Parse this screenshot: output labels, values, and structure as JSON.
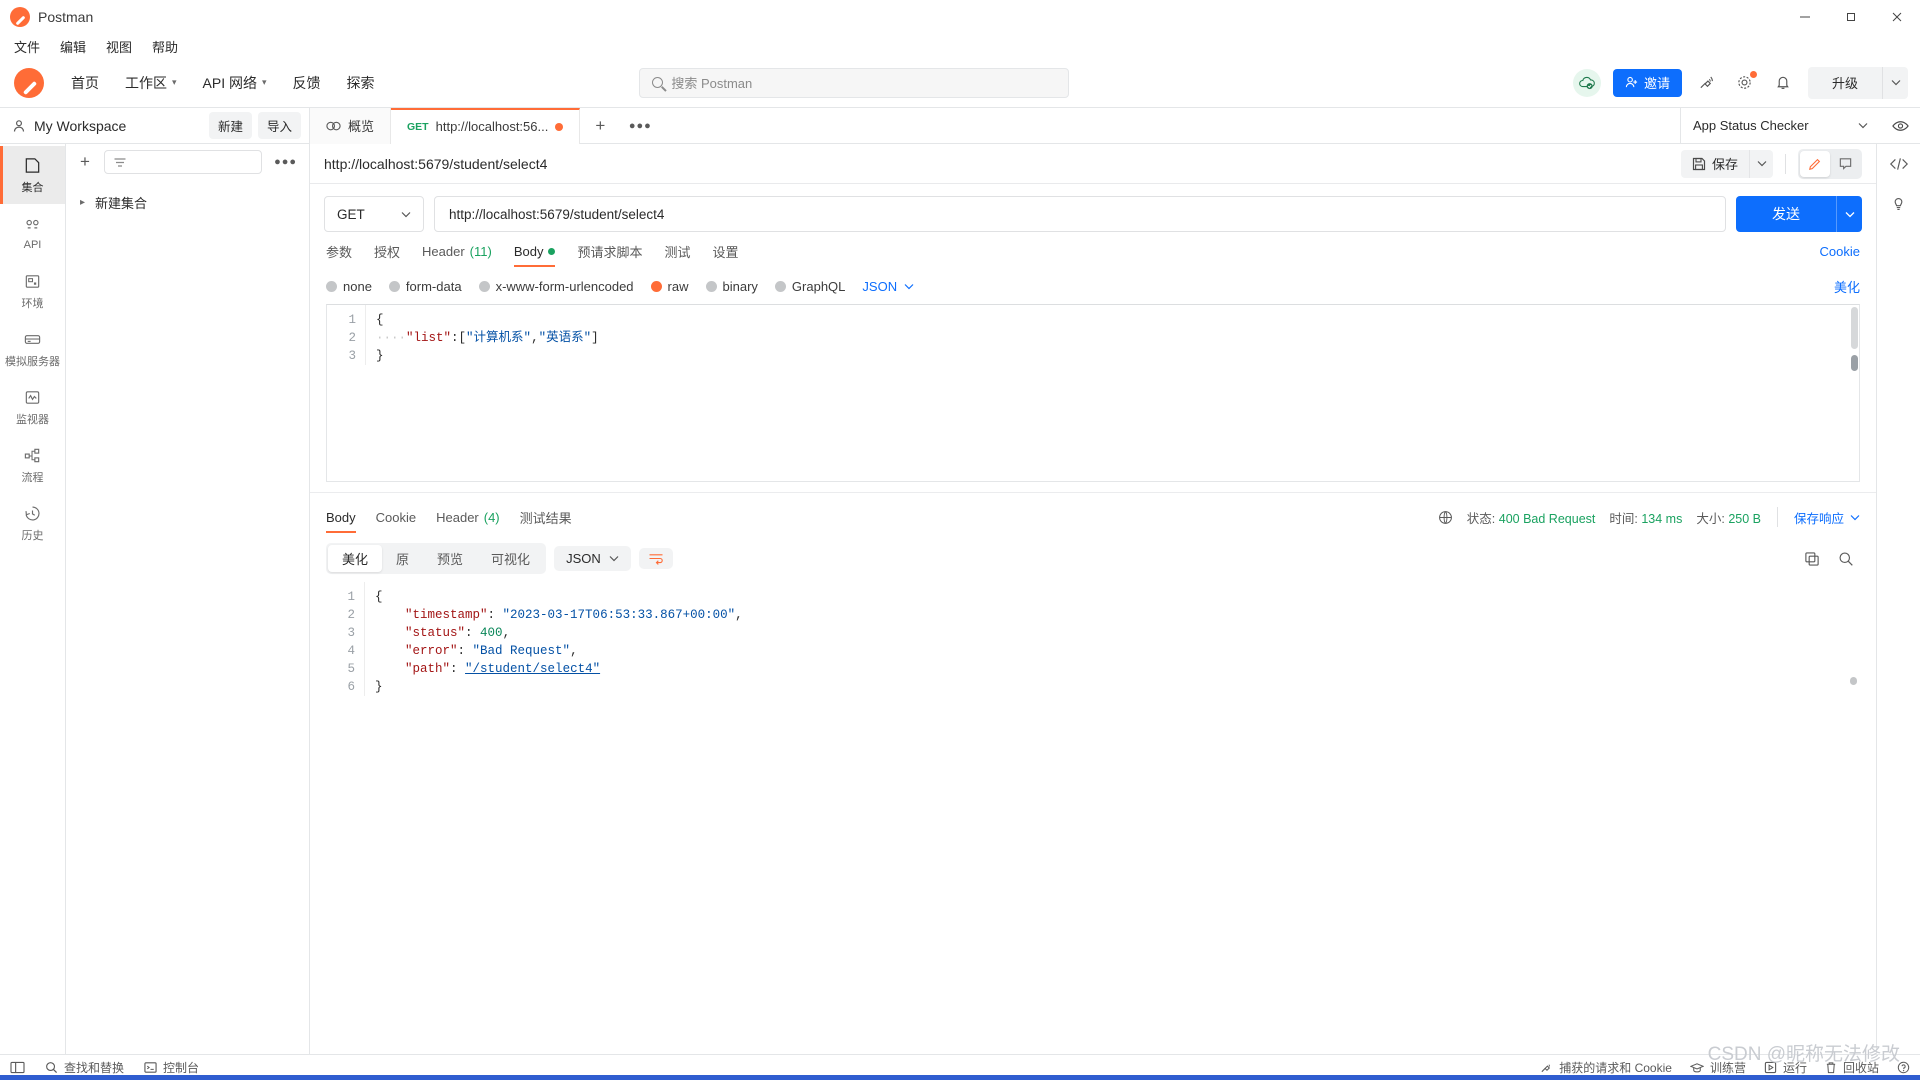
{
  "window": {
    "title": "Postman",
    "minimize": "—",
    "maximize": "❐",
    "close": "✕"
  },
  "menubar": [
    "文件",
    "编辑",
    "视图",
    "帮助"
  ],
  "header": {
    "nav": [
      {
        "label": "首页",
        "caret": false
      },
      {
        "label": "工作区",
        "caret": true
      },
      {
        "label": "API 网络",
        "caret": true
      },
      {
        "label": "反馈",
        "caret": false
      },
      {
        "label": "探索",
        "caret": false
      }
    ],
    "search_placeholder": "搜索 Postman",
    "invite_label": "邀请",
    "upgrade_label": "升级",
    "caret": "⌄"
  },
  "workspace": {
    "name": "My Workspace",
    "new_label": "新建",
    "import_label": "导入",
    "environment": "App Status Checker"
  },
  "tabs": [
    {
      "label": "概览",
      "method": "",
      "active": false,
      "unsaved": false
    },
    {
      "label": "http://localhost:56...",
      "method": "GET",
      "active": true,
      "unsaved": true
    }
  ],
  "rail": [
    {
      "label": "集合",
      "icon": "collection-icon",
      "active": true
    },
    {
      "label": "API",
      "icon": "api-icon",
      "active": false
    },
    {
      "label": "环境",
      "icon": "environment-icon",
      "active": false
    },
    {
      "label": "模拟服务器",
      "icon": "mock-server-icon",
      "active": false
    },
    {
      "label": "监视器",
      "icon": "monitor-icon",
      "active": false
    },
    {
      "label": "流程",
      "icon": "flows-icon",
      "active": false
    },
    {
      "label": "历史",
      "icon": "history-icon",
      "active": false
    }
  ],
  "sidebar": {
    "filter_placeholder": "",
    "tree": [
      {
        "label": "新建集合"
      }
    ]
  },
  "request": {
    "title": "http://localhost:5679/student/select4",
    "save_label": "保存",
    "method": "GET",
    "url": "http://localhost:5679/student/select4",
    "send_label": "发送",
    "tabs": [
      {
        "label": "参数",
        "active": false,
        "badge": ""
      },
      {
        "label": "授权",
        "active": false,
        "badge": ""
      },
      {
        "label": "Header",
        "active": false,
        "badge": "(11)"
      },
      {
        "label": "Body",
        "active": true,
        "badge": "",
        "dot": true
      },
      {
        "label": "预请求脚本",
        "active": false,
        "badge": ""
      },
      {
        "label": "测试",
        "active": false,
        "badge": ""
      },
      {
        "label": "设置",
        "active": false,
        "badge": ""
      }
    ],
    "cookie_link": "Cookie",
    "body_types": [
      {
        "label": "none",
        "selected": false
      },
      {
        "label": "form-data",
        "selected": false
      },
      {
        "label": "x-www-form-urlencoded",
        "selected": false
      },
      {
        "label": "raw",
        "selected": true
      },
      {
        "label": "binary",
        "selected": false
      },
      {
        "label": "GraphQL",
        "selected": false
      }
    ],
    "format": "JSON",
    "beautify_label": "美化",
    "body_lines": [
      {
        "n": "1",
        "text": "{"
      },
      {
        "n": "2",
        "text": "    \"list\":[\"计算机系\",\"英语系\"]"
      },
      {
        "n": "3",
        "text": "}"
      }
    ]
  },
  "response": {
    "tabs": [
      {
        "label": "Body",
        "active": true,
        "badge": ""
      },
      {
        "label": "Cookie",
        "active": false,
        "badge": ""
      },
      {
        "label": "Header",
        "active": false,
        "badge": "(4)"
      },
      {
        "label": "测试结果",
        "active": false,
        "badge": ""
      }
    ],
    "status_label": "状态:",
    "status_value": "400 Bad Request",
    "time_label": "时间:",
    "time_value": "134 ms",
    "size_label": "大小:",
    "size_value": "250 B",
    "save_response": "保存响应",
    "view_modes": [
      {
        "label": "美化",
        "active": true
      },
      {
        "label": "原",
        "active": false
      },
      {
        "label": "预览",
        "active": false
      },
      {
        "label": "可视化",
        "active": false
      }
    ],
    "format": "JSON",
    "body_lines": [
      {
        "n": "1",
        "text": "{"
      },
      {
        "n": "2",
        "text": "    \"timestamp\": \"2023-03-17T06:53:33.867+00:00\","
      },
      {
        "n": "3",
        "text": "    \"status\": 400,"
      },
      {
        "n": "4",
        "text": "    \"error\": \"Bad Request\","
      },
      {
        "n": "5",
        "text": "    \"path\": \"/student/select4\""
      },
      {
        "n": "6",
        "text": "}"
      }
    ]
  },
  "statusbar": {
    "left": [
      {
        "label": "查找和替换",
        "icon": "search-icon"
      },
      {
        "label": "控制台",
        "icon": "console-icon"
      }
    ],
    "right": [
      {
        "label": "捕获的请求和 Cookie",
        "icon": "capture-icon"
      },
      {
        "label": "训练营",
        "icon": "bootcamp-icon"
      },
      {
        "label": "运行",
        "icon": "runner-icon"
      },
      {
        "label": "回收站",
        "icon": "trash-icon"
      },
      {
        "label": "",
        "icon": "help-icon"
      }
    ]
  },
  "watermark": "CSDN @昵称无法修改",
  "colors": {
    "accent": "#ff6c37",
    "primary": "#0d6efd",
    "success": "#1aa260",
    "border": "#e4e6e8"
  }
}
